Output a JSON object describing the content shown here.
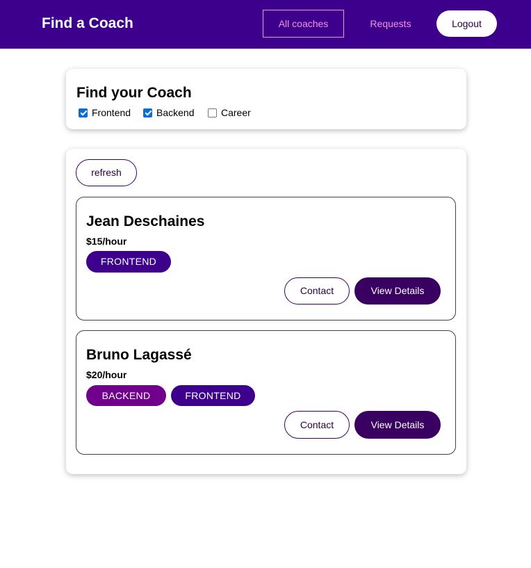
{
  "header": {
    "brand": "Find a Coach",
    "nav": {
      "all_coaches": "All coaches",
      "requests": "Requests",
      "logout": "Logout"
    }
  },
  "filter": {
    "title": "Find your Coach",
    "options": [
      {
        "label": "Frontend",
        "checked": true
      },
      {
        "label": "Backend",
        "checked": true
      },
      {
        "label": "Career",
        "checked": false
      }
    ]
  },
  "list": {
    "refresh_label": "refresh",
    "coaches": [
      {
        "name": "Jean Deschaines",
        "rate": "$15/hour",
        "areas": [
          "FRONTEND"
        ],
        "contact_label": "Contact",
        "details_label": "View Details"
      },
      {
        "name": "Bruno Lagassé",
        "rate": "$20/hour",
        "areas": [
          "BACKEND",
          "FRONTEND"
        ],
        "contact_label": "Contact",
        "details_label": "View Details"
      }
    ]
  },
  "colors": {
    "header_bg": "#3d008d",
    "nav_link": "#f391e3",
    "button_primary": "#3a0061",
    "badge_frontend": "#3d008d",
    "badge_backend": "#71008d",
    "checkbox_checked": "#0b6cd6"
  }
}
